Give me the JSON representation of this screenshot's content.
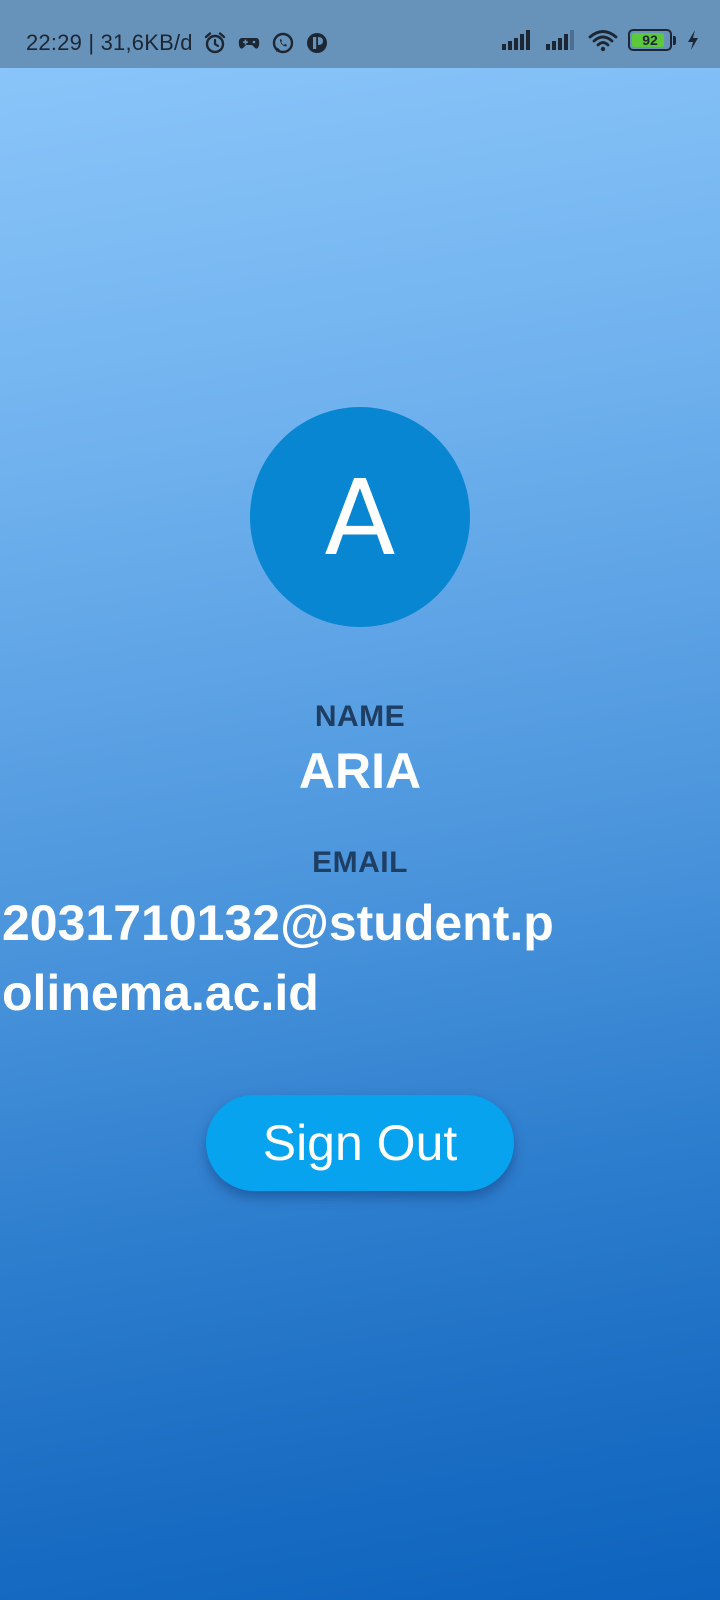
{
  "status_bar": {
    "time_speed": "22:29 | 31,6KB/d",
    "battery_level": "92",
    "battery_fill_percent": 92,
    "icons": [
      "alarm-icon",
      "game-controller-icon",
      "whatsapp-icon",
      "app-notification-icon",
      "signal-icon",
      "signal-icon",
      "wifi-icon",
      "battery-icon",
      "charging-icon"
    ]
  },
  "profile": {
    "avatar_letter": "A",
    "name_label": "NAME",
    "name_value": "ARIA",
    "email_label": "EMAIL",
    "email_value": "2031710132@student.polinema.ac.id"
  },
  "actions": {
    "sign_out_label": "Sign Out"
  },
  "colors": {
    "avatar_bg": "#0886d2",
    "button_bg": "#08a3ef",
    "label_color": "#1e3e63",
    "status_bar_bg": "#6792b9"
  }
}
